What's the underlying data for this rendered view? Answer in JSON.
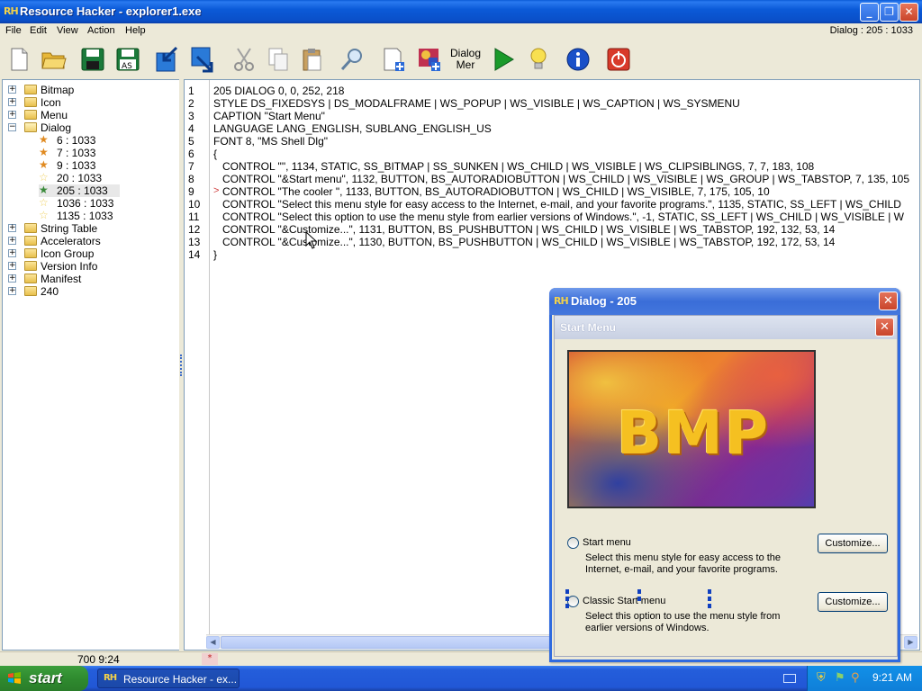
{
  "window": {
    "app_icon": "RH",
    "title": "Resource Hacker - explorer1.exe"
  },
  "menubar": {
    "items": [
      "File",
      "Edit",
      "View",
      "Action",
      "Help"
    ],
    "status_right": "Dialog : 205 : 1033"
  },
  "toolbar": {
    "dialog_menu_label_line1": "Dialog",
    "dialog_menu_label_line2": "Mer",
    "icons": [
      "new-file-icon",
      "open-folder-icon",
      "save-icon",
      "save-as-icon",
      "import-icon",
      "export-icon",
      "cut-icon",
      "copy-icon",
      "paste-icon",
      "find-icon",
      "add-resource-icon",
      "add-image-icon",
      "dialog-menu-icon",
      "run-script-icon",
      "hint-icon",
      "about-icon",
      "exit-icon"
    ]
  },
  "tree": {
    "top_nodes": [
      "Bitmap",
      "Icon",
      "Menu",
      "Dialog"
    ],
    "dialog_children": [
      "6 : 1033",
      "7 : 1033",
      "9 : 1033",
      "20 : 1033",
      "205 : 1033",
      "1036 : 1033",
      "1135 : 1033"
    ],
    "bottom_nodes": [
      "String Table",
      "Accelerators",
      "Icon Group",
      "Version Info",
      "Manifest",
      "240"
    ]
  },
  "editor": {
    "line_numbers": [
      "1",
      "2",
      "3",
      "4",
      "5",
      "6",
      "7",
      "8",
      "9",
      "10",
      "11",
      "12",
      "13",
      "14"
    ],
    "lines": [
      "205 DIALOG 0, 0, 252, 218",
      "STYLE DS_FIXEDSYS | DS_MODALFRAME | WS_POPUP | WS_VISIBLE | WS_CAPTION | WS_SYSMENU",
      "CAPTION \"Start Menu\"",
      "LANGUAGE LANG_ENGLISH, SUBLANG_ENGLISH_US",
      "FONT 8, \"MS Shell Dlg\"",
      "{",
      "   CONTROL \"\", 1134, STATIC, SS_BITMAP | SS_SUNKEN | WS_CHILD | WS_VISIBLE | WS_CLIPSIBLINGS, 7, 7, 183, 108",
      "   CONTROL \"&Start menu\", 1132, BUTTON, BS_AUTORADIOBUTTON | WS_CHILD | WS_VISIBLE | WS_GROUP | WS_TABSTOP, 7, 135, 105",
      "   CONTROL \"The cooler \", 1133, BUTTON, BS_AUTORADIOBUTTON | WS_CHILD | WS_VISIBLE, 7, 175, 105, 10",
      "   CONTROL \"Select this menu style for easy access to the Internet, e-mail, and your favorite programs.\", 1135, STATIC, SS_LEFT | WS_CHILD",
      "   CONTROL \"Select this option to use the menu style from earlier versions of Windows.\", -1, STATIC, SS_LEFT | WS_CHILD | WS_VISIBLE | W",
      "   CONTROL \"&Customize...\", 1131, BUTTON, BS_PUSHBUTTON | WS_CHILD | WS_VISIBLE | WS_TABSTOP, 192, 132, 53, 14",
      "   CONTROL \"&Customize...\", 1130, BUTTON, BS_PUSHBUTTON | WS_CHILD | WS_VISIBLE | WS_TABSTOP, 192, 172, 53, 14",
      "}"
    ],
    "marker": ">"
  },
  "statusbar": {
    "position": "700   9:24",
    "modified": "*"
  },
  "dialog_preview": {
    "app_icon": "RH",
    "title": "Dialog -  205",
    "inner_title": "Start Menu",
    "bitmap_text": "BMP",
    "option1_label": "Start menu",
    "option1_desc_line1": "Select this menu style for easy access to the",
    "option1_desc_line2": "Internet, e-mail, and your favorite programs.",
    "option2_label": "Classic Start menu",
    "option2_desc_line1": "Select this option to use the menu style from",
    "option2_desc_line2": "earlier versions of Windows.",
    "customize1": "Customize...",
    "customize2": "Customize..."
  },
  "taskbar": {
    "start_label": "start",
    "task_icon": "RH",
    "task_label": "Resource Hacker - ex...",
    "clock": "9:21 AM"
  }
}
